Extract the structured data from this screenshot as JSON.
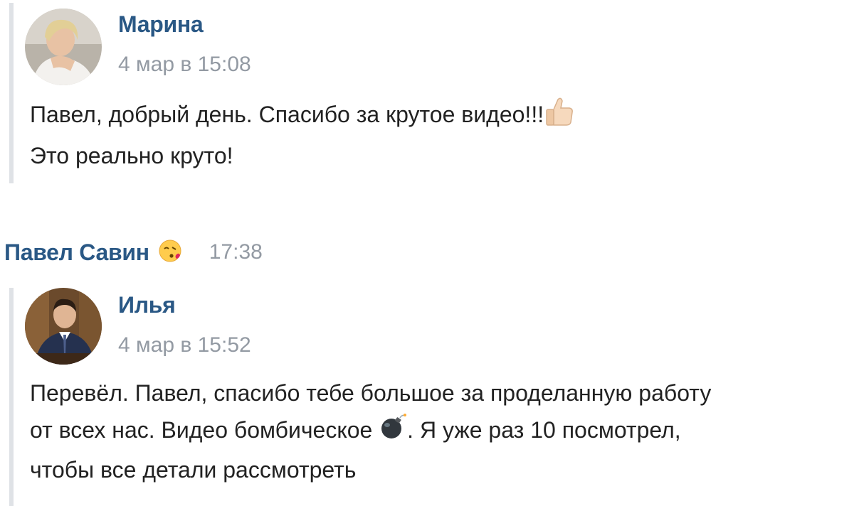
{
  "quote1": {
    "author": "Марина",
    "date": "4 мар в 15:08",
    "line1": "Павел, добрый день. Спасибо за крутое видео!!!",
    "line1_emoji": "thumbs-up-icon",
    "line2": "Это реально круто!"
  },
  "reply": {
    "author": "Павел Савин",
    "author_emoji": "kissing-face-icon",
    "time": "17:38"
  },
  "quote2": {
    "author": "Илья",
    "date": "4 мар в 15:52",
    "line1": "Перевёл. Павел, спасибо тебе большое за проделанную работу",
    "line2_part1": "от всех нас. Видео бомбическое",
    "line2_emoji": "bomb-icon",
    "line2_part2": ". Я уже раз 10 посмотрел,",
    "line3": "чтобы все детали рассмотреть"
  },
  "colors": {
    "link": "#2a5885",
    "muted": "#939aa3",
    "text": "#222222",
    "quote_bar": "#dfe2e6"
  }
}
